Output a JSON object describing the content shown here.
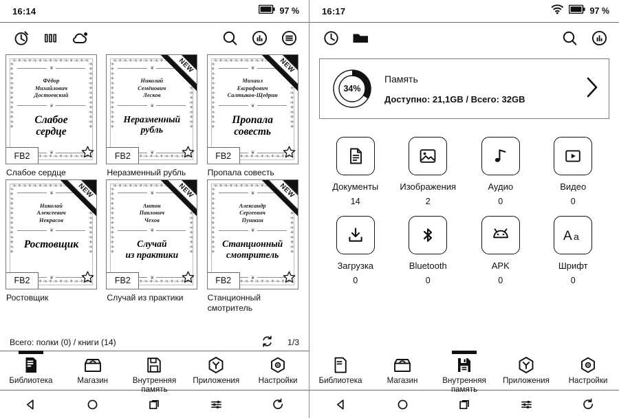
{
  "left": {
    "status": {
      "time": "16:14",
      "battery_pct": "97 %",
      "battery_icon": "battery-icon"
    },
    "toolbar": {
      "left_icons": [
        {
          "name": "recent-clock-icon",
          "label": "Недавние"
        },
        {
          "name": "bookshelf-icon",
          "label": "Полки"
        },
        {
          "name": "cloud-icon",
          "label": "Облако"
        }
      ],
      "right_icons": [
        {
          "name": "search-icon",
          "label": "Поиск"
        },
        {
          "name": "stats-circle-icon",
          "label": "Статистика"
        },
        {
          "name": "menu-circle-icon",
          "label": "Меню"
        }
      ]
    },
    "books": [
      {
        "author": "Фёдор\nМихайлович\nДостоевский",
        "cover_title": "Слабое\nсердце",
        "title": "Слабое сердце",
        "format": "FB2",
        "is_new": false,
        "favorite": true
      },
      {
        "author": "Николай\nСемёнович\nЛесков",
        "cover_title": "Неразменный\nрубль",
        "title": "Неразменный рубль",
        "format": "FB2",
        "is_new": true,
        "favorite": true
      },
      {
        "author": "Михаил\nЕвграфович\nСалтыков-Щедрин",
        "cover_title": "Пропала\nсовесть",
        "title": "Пропала совесть",
        "format": "FB2",
        "is_new": true,
        "favorite": true
      },
      {
        "author": "Николай\nАлексеевич\nНекрасов",
        "cover_title": "Ростовщик",
        "title": "Ростовщик",
        "format": "FB2",
        "is_new": true,
        "favorite": true
      },
      {
        "author": "Антон\nПавлович\nЧехов",
        "cover_title": "Случай\nиз практики",
        "title": "Случай из практики",
        "format": "FB2",
        "is_new": true,
        "favorite": true
      },
      {
        "author": "Александр\nСергеевич\nПушкин",
        "cover_title": "Станционный\nсмотритель",
        "title": "Станционный смотритель",
        "format": "FB2",
        "is_new": true,
        "favorite": true
      }
    ],
    "footer": {
      "totals": "Всего: полки (0) / книги (14)",
      "refresh_icon": "refresh-icon",
      "page": "1/3"
    },
    "tabs": [
      {
        "label": "Библиотека",
        "icon": "library-icon",
        "active": true
      },
      {
        "label": "Магазин",
        "icon": "store-icon",
        "active": false
      },
      {
        "label": "Внутренняя\nпамять",
        "icon": "save-disk-icon",
        "active": false
      },
      {
        "label": "Приложения",
        "icon": "apps-hex-icon",
        "active": false
      },
      {
        "label": "Настройки",
        "icon": "settings-hex-icon",
        "active": false
      }
    ]
  },
  "right": {
    "status": {
      "time": "16:17",
      "battery_pct": "97 %",
      "wifi_icon": "wifi-icon",
      "battery_icon": "battery-icon"
    },
    "toolbar": {
      "left_icons": [
        {
          "name": "recent-clock-icon",
          "label": "Недавние"
        },
        {
          "name": "folder-icon",
          "label": "Папки"
        }
      ],
      "right_icons": [
        {
          "name": "search-icon",
          "label": "Поиск"
        },
        {
          "name": "stats-circle-icon",
          "label": "Статистика"
        }
      ]
    },
    "memory": {
      "title": "Память",
      "percent_label": "34%",
      "percent_value": 34,
      "detail": "Доступно: 21,1GB / Всего: 32GB",
      "chevron_icon": "chevron-right-icon"
    },
    "categories": [
      {
        "label": "Документы",
        "count": "14",
        "icon": "document-icon"
      },
      {
        "label": "Изображения",
        "count": "2",
        "icon": "image-icon"
      },
      {
        "label": "Аудио",
        "count": "0",
        "icon": "audio-note-icon"
      },
      {
        "label": "Видео",
        "count": "0",
        "icon": "video-play-icon"
      },
      {
        "label": "Загрузка",
        "count": "0",
        "icon": "download-icon"
      },
      {
        "label": "Bluetooth",
        "count": "0",
        "icon": "bluetooth-icon"
      },
      {
        "label": "APK",
        "count": "0",
        "icon": "android-icon"
      },
      {
        "label": "Шрифт",
        "count": "0",
        "icon": "font-aa-icon"
      }
    ],
    "tabs": [
      {
        "label": "Библиотека",
        "icon": "library-icon",
        "active": false
      },
      {
        "label": "Магазин",
        "icon": "store-icon",
        "active": false
      },
      {
        "label": "Внутренняя\nпамять",
        "icon": "save-disk-icon",
        "active": true
      },
      {
        "label": "Приложения",
        "icon": "apps-hex-icon",
        "active": false
      },
      {
        "label": "Настройки",
        "icon": "settings-hex-icon",
        "active": false
      }
    ]
  },
  "navbar": [
    {
      "name": "back-nav-icon"
    },
    {
      "name": "home-nav-icon"
    },
    {
      "name": "recents-nav-icon"
    },
    {
      "name": "settings-sliders-nav-icon"
    },
    {
      "name": "refresh-nav-icon"
    }
  ],
  "colors": {
    "ink": "#111111",
    "paper": "#ffffff",
    "rule": "#6d6d6d",
    "ornament": "#9d9d9d"
  }
}
